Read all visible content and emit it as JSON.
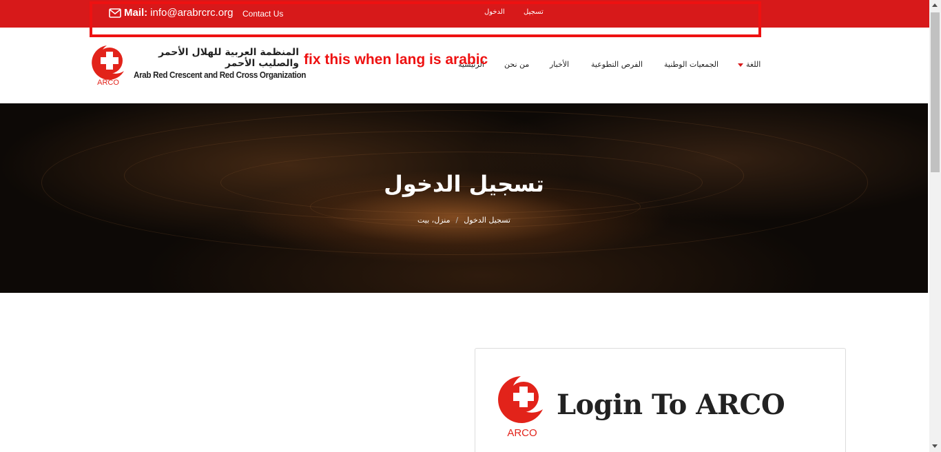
{
  "topbar": {
    "mail_label": "Mail:",
    "mail_value": "info@arabrcrc.org",
    "contact": "Contact Us",
    "login": "الدخول",
    "register": "تسجيل",
    "background_color": "#d7191a",
    "mail_icon": "envelope-icon"
  },
  "header": {
    "logo_caption": "ARCO",
    "org_name_ar": "المنظمة العربية للهلال الأحمر والصليب الأحمر",
    "org_name_en": "Arab Red Crescent and Red Cross Organization",
    "nav": {
      "language": "اللغة",
      "national_societies": "الجمعيات الوطنية",
      "volunteer": "الفرص التطوعية",
      "news": "الأخبار",
      "about": "من نحن",
      "home": "الرئيسية"
    }
  },
  "annotation": {
    "text": "fix this when lang is arabic",
    "color": "#ee1111"
  },
  "hero": {
    "title": "تسجيل الدخول",
    "breadcrumb_current": "تسجيل الدخول",
    "breadcrumb_separator": "/",
    "breadcrumb_home": "منزل، بيت"
  },
  "login_card": {
    "title": "Login To ARCO",
    "logo_caption": "ARCO"
  }
}
